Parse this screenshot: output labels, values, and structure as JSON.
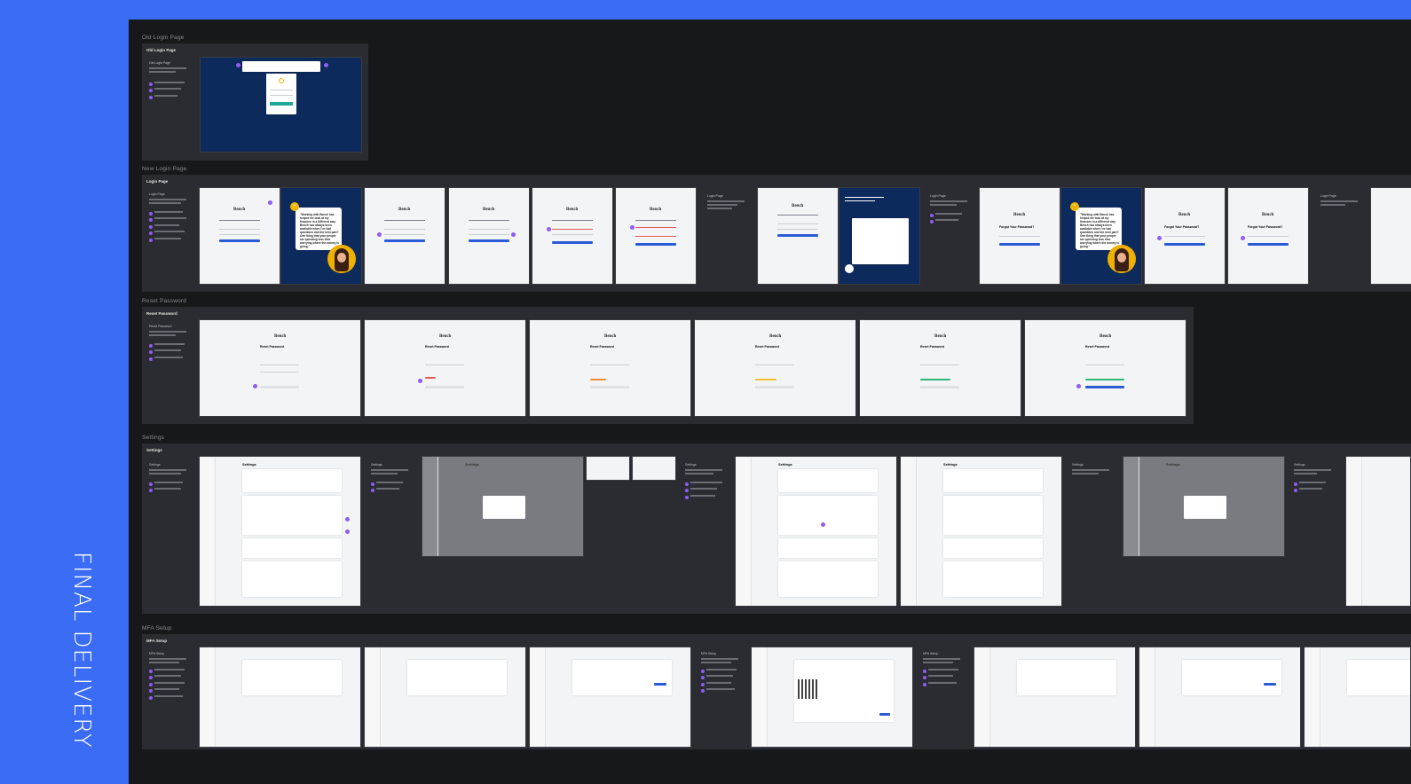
{
  "deliverable": {
    "title": "FINAL DELIVERY"
  },
  "sections": {
    "old_login": {
      "label": "Old Login Page",
      "inner": "Old Login Page"
    },
    "new_login": {
      "label": "New Login Page",
      "inner": "Login Page"
    },
    "reset_password": {
      "label": "Reset Password",
      "inner": "Reset Password"
    },
    "settings": {
      "label": "Settings",
      "inner": "Settings"
    },
    "mfa_setup": {
      "label": "MFA Setup",
      "inner": "MFA Setup"
    }
  },
  "notes": {
    "old_login": "Old Login Page",
    "login": "Login Page",
    "reset": "Reset Password",
    "settings": "Settings",
    "mfa": "MFA Setup"
  },
  "screens": {
    "brand": "Bench",
    "signin": "Sign in to Bench Accounting",
    "forgot": "Forgot Your Password?",
    "reset": "Reset Password",
    "settings_title": "Settings",
    "testimonial": "\"Working with Bench has helped me look at my finances in a different way. Bench has always been available when I've had questions and the best part? One thing that your people are spending less time worrying where the money is going.\""
  },
  "colors": {
    "accent": "#3b6cf5",
    "canvas": "#17181b",
    "section": "#2b2c31",
    "marker": "#8f5cf6",
    "button": "#2a5bd7"
  }
}
